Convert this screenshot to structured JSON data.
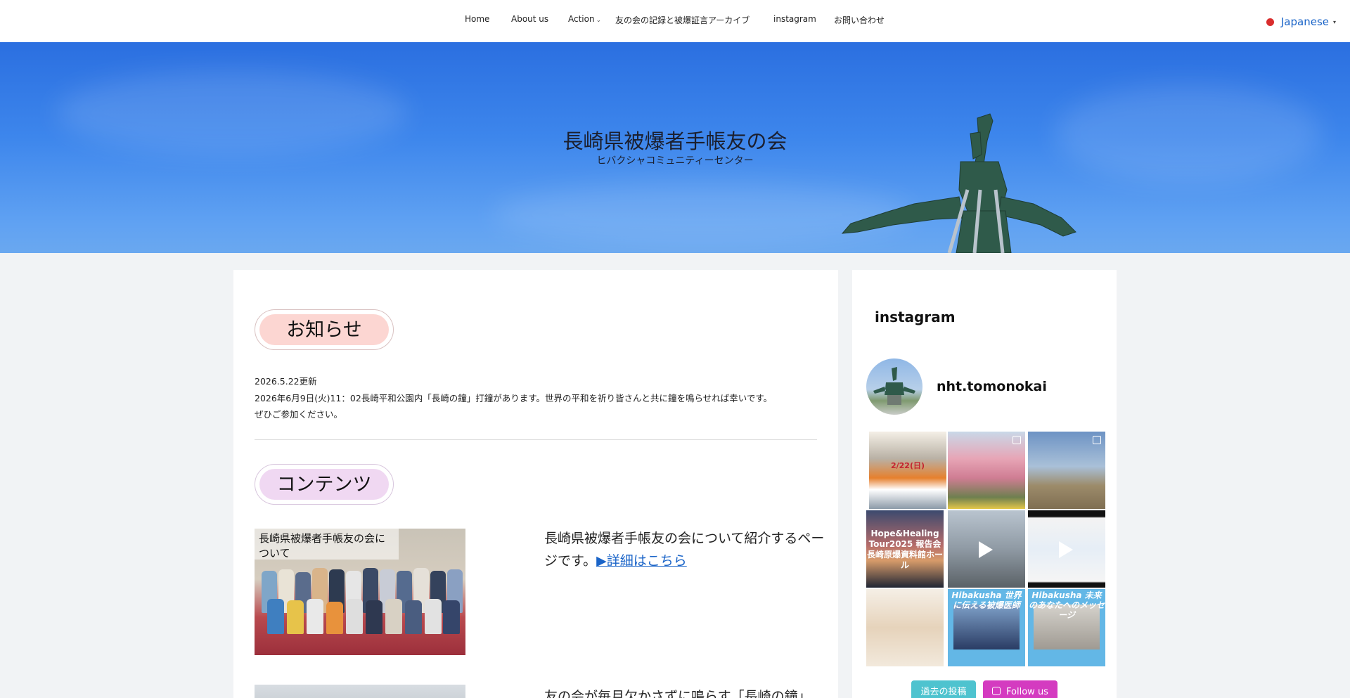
{
  "nav": {
    "items": [
      {
        "label": "Home"
      },
      {
        "label": "About us"
      },
      {
        "label": "Action"
      },
      {
        "label": "友の会の記録と被爆証言アーカイブ"
      },
      {
        "label": "instagram"
      },
      {
        "label": "お問い合わせ"
      }
    ],
    "action_caret": "⌄"
  },
  "language": {
    "label": "Japanese",
    "arrow": "▾"
  },
  "hero": {
    "title": "長崎県被爆者手帳友の会",
    "subtitle": "ヒバクシャコミュニティーセンター"
  },
  "news": {
    "heading": "お知らせ",
    "date": "2026.5.22更新",
    "line1": "2026年6月9日(火)11：02長崎平和公園内「長崎の鐘」打鐘があります。世界の平和を祈り皆さんと共に鐘を鳴らせれば幸いです。",
    "line2": "ぜひご参加ください。"
  },
  "contents": {
    "heading": "コンテンツ",
    "item1": {
      "caption": "長崎県被爆者手帳友の会について",
      "text": "長崎県被爆者手帳友の会について紹介するページです。",
      "link": "▶詳細はこちら"
    },
    "item2": {
      "text": "友の会が毎月欠かさずに鳴らす「長崎の鐘」"
    }
  },
  "sidebar": {
    "title": "instagram",
    "handle": "nht.tomonokai",
    "tiles": [
      {
        "text": "2/22(日)"
      },
      {
        "text": ""
      },
      {
        "text": ""
      },
      {
        "text": "Hope&Healing Tour2025 報告会 長崎原爆資料館ホール"
      },
      {
        "text": ""
      },
      {
        "text": ""
      },
      {
        "text": ""
      },
      {
        "text": "Hibakusha 世界に伝える被爆医師"
      },
      {
        "text": "Hibakusha 未来のあなたへのメッセージ"
      }
    ],
    "past_posts_label": "過去の投稿",
    "follow_label": "Follow us",
    "colors": {
      "past": "#4ec3cf",
      "follow": "#d43bc0"
    }
  }
}
